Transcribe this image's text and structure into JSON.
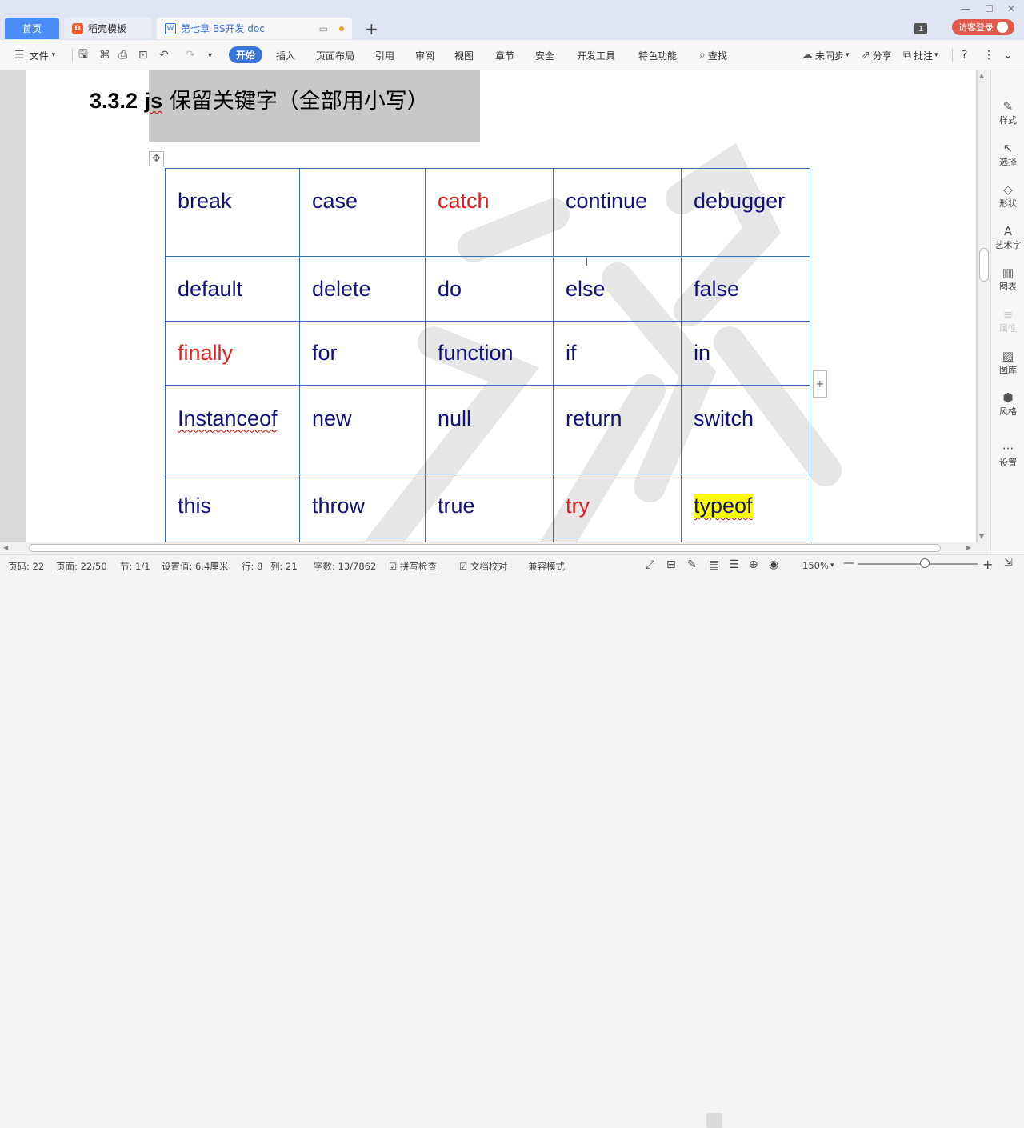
{
  "tabs": {
    "home": "首页",
    "template": "稻壳模板",
    "template_icon": "D",
    "document": "第七章 BS开发.doc",
    "doc_icon": "W",
    "add": "+"
  },
  "window": {
    "badge": "1",
    "guest_login": "访客登录",
    "minimize": "—",
    "maximize": "☐",
    "close": "✕"
  },
  "ribbon": {
    "menu": "文件",
    "tabs": [
      "开始",
      "插入",
      "页面布局",
      "引用",
      "审阅",
      "视图",
      "章节",
      "安全",
      "开发工具",
      "特色功能"
    ],
    "search": "查找",
    "sync": "未同步",
    "share": "分享",
    "comment": "批注",
    "help": "?",
    "more": "⋮",
    "collapse": "⌄"
  },
  "document": {
    "heading_number": "3.3.2",
    "heading_js": "js",
    "heading_text": " 保留关键字（全部用小写）",
    "table": [
      [
        "break",
        "case",
        "catch",
        "continue",
        "debugger"
      ],
      [
        "default",
        "delete",
        "do",
        "else",
        "false"
      ],
      [
        "finally",
        "for",
        "function",
        "if",
        "in"
      ],
      [
        "Instanceof",
        "new",
        "null",
        "return",
        "switch"
      ],
      [
        "this",
        "throw",
        "true",
        "try",
        "typeof"
      ]
    ],
    "red_keywords": [
      "catch",
      "finally",
      "try"
    ],
    "highlighted_keyword": "typeof",
    "accent_color": "#e41b1b",
    "keyword_color": "#11117a",
    "highlight_color": "#ffff00"
  },
  "right_panel": {
    "items": [
      "样式",
      "选择",
      "形状",
      "艺术字",
      "图表",
      "属性",
      "图库",
      "风格",
      "设置"
    ]
  },
  "status": {
    "page_code": "页码: 22",
    "page": "页面: 22/50",
    "section": "节: 1/1",
    "setting": "设置值: 6.4厘米",
    "row": "行: 8",
    "col": "列: 21",
    "words": "字数: 13/7862",
    "spell": "拼写检查",
    "proof": "文档校对",
    "compat": "兼容模式",
    "zoom": "150%",
    "zoom_percent": 150,
    "minus": "—",
    "plus": "+"
  }
}
